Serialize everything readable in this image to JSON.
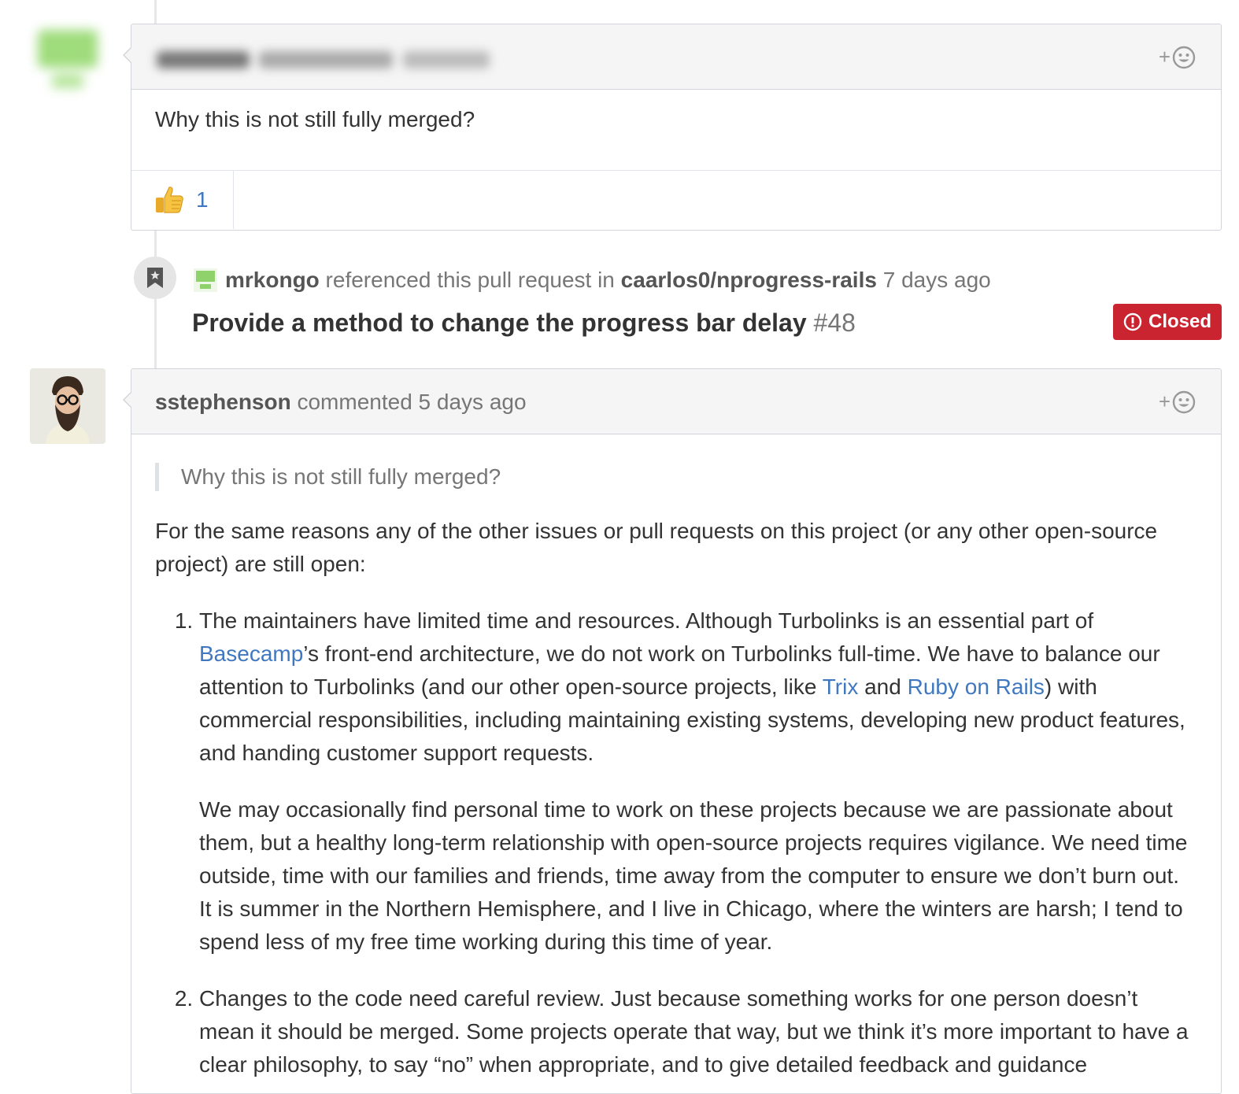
{
  "comment1": {
    "body": "Why this is not still fully merged?",
    "reaction": {
      "emoji": "👍",
      "count": "1"
    },
    "add_reaction": "+"
  },
  "reference": {
    "user": "mrkongo",
    "action": " referenced this pull request in ",
    "repo": "caarlos0/nprogress-rails",
    "time": " 7 days ago",
    "title": "Provide a method to change the progress bar delay",
    "number": " #48",
    "status": "Closed",
    "status_color": "#cb2431"
  },
  "comment2": {
    "author": "sstephenson",
    "meta": " commented 5 days ago",
    "add_reaction": "+",
    "quote": "Why this is not still fully merged?",
    "intro": "For the same reasons any of the other issues or pull requests on this project (or any other open-source project) are still open:",
    "item1": {
      "part1": "The maintainers have limited time and resources. Although Turbolinks is an essential part of ",
      "link_basecamp": "Basecamp",
      "part2": "’s front-end architecture, we do not work on Turbolinks full-time. We have to balance our attention to Turbolinks (and our other open-source projects, like ",
      "link_trix": "Trix",
      "part3": " and ",
      "link_rails": "Ruby on Rails",
      "part4": ") with commercial responsibilities, including maintaining existing systems, developing new product features, and handing customer support requests.",
      "para2": "We may occasionally find personal time to work on these projects because we are passionate about them, but a healthy long-term relationship with open-source projects requires vigilance. We need time outside, time with our families and friends, time away from the computer to ensure we don’t burn out. It is summer in the Northern Hemisphere, and I live in Chicago, where the winters are harsh; I tend to spend less of my free time working during this time of year."
    },
    "item2": "Changes to the code need careful review. Just because something works for one person doesn’t mean it should be merged. Some projects operate that way, but we think it’s more important to have a clear philosophy, to say “no” when appropriate, and to give detailed feedback and guidance"
  },
  "colors": {
    "link": "#4078c0",
    "header_bg": "#f5f5f5",
    "border": "#d1d5da"
  }
}
